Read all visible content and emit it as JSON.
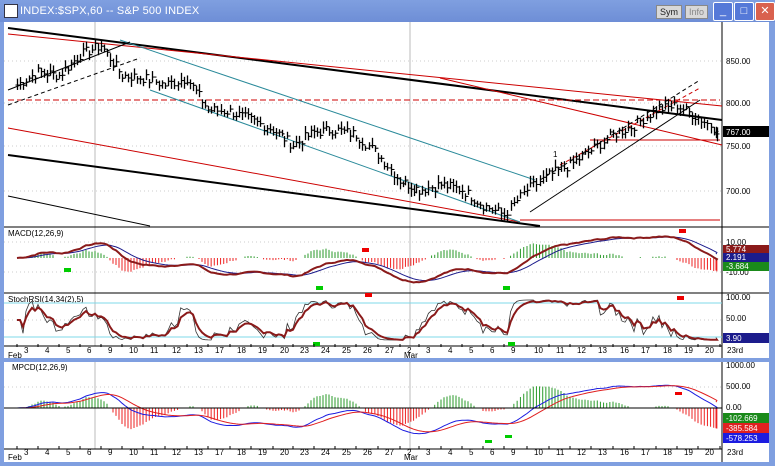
{
  "window": {
    "title": "INDEX:$SPX,60  -- S&P 500 INDEX",
    "buttons": {
      "sym": "Sym",
      "info": "Info",
      "minimize": "_",
      "maximize": "□",
      "close": "✕"
    }
  },
  "colors": {
    "frame": "#7f9fe0",
    "price_bars": "#000000",
    "signal_red": "#cc0000",
    "hist_green": "#2a9a2a",
    "hist_red": "#ee2222",
    "cyan": "#7fd8e8",
    "navy": "#1c1c8c"
  },
  "price_panel": {
    "axis_labels": [
      "850.00",
      "800.00",
      "750.00",
      "700.00"
    ],
    "last_price_tag": "767.00",
    "wave_label": "1"
  },
  "macd_panel": {
    "label": "MACD(12,26,9)",
    "axis_labels": [
      "10.00",
      "-10.00"
    ],
    "value_tags": [
      "5.774",
      "2.191",
      "-3.684"
    ]
  },
  "stochrsi_panel": {
    "label": "StochRSI(14,34(2),5)",
    "axis_labels": [
      "100.00",
      "50.00"
    ],
    "value_tag": "3.90"
  },
  "date_axis": {
    "months": [
      "Feb",
      "Mar"
    ],
    "days": [
      "3",
      "4",
      "5",
      "6",
      "9",
      "10",
      "11",
      "12",
      "13",
      "17",
      "18",
      "19",
      "20",
      "23",
      "24",
      "25",
      "26",
      "27",
      "2",
      "3",
      "4",
      "5",
      "6",
      "9",
      "10",
      "11",
      "12",
      "13",
      "16",
      "17",
      "18",
      "19",
      "20",
      "23rd"
    ]
  },
  "mpcd_panel": {
    "label": "MPCD(12,26,9)",
    "axis_labels": [
      "1000.00",
      "500.00",
      "0.00"
    ],
    "value_tags": [
      "-102.669",
      "-385.584",
      "-578.253"
    ]
  },
  "chart_data": {
    "type": "bar",
    "title": "INDEX:$SPX,60  -- S&P 500 INDEX",
    "x": [
      "Feb 3",
      "Feb 4",
      "Feb 5",
      "Feb 6",
      "Feb 9",
      "Feb 10",
      "Feb 11",
      "Feb 12",
      "Feb 13",
      "Feb 17",
      "Feb 18",
      "Feb 19",
      "Feb 20",
      "Feb 23",
      "Feb 24",
      "Feb 25",
      "Feb 26",
      "Feb 27",
      "Mar 2",
      "Mar 3",
      "Mar 4",
      "Mar 5",
      "Mar 6",
      "Mar 9",
      "Mar 10",
      "Mar 11",
      "Mar 12",
      "Mar 13",
      "Mar 16",
      "Mar 17",
      "Mar 18",
      "Mar 19",
      "Mar 20",
      "Mar 23"
    ],
    "series": [
      {
        "values": [
          821,
          836,
          832,
          856,
          867,
          832,
          829,
          821,
          829,
          792,
          790,
          780,
          769,
          751,
          766,
          769,
          763,
          740,
          710,
          699,
          705,
          699,
          681,
          670,
          699,
          716,
          728,
          745,
          763,
          774,
          792,
          797,
          783,
          767
        ]
      }
    ],
    "ylim": [
      660,
      880
    ],
    "grid": true
  }
}
